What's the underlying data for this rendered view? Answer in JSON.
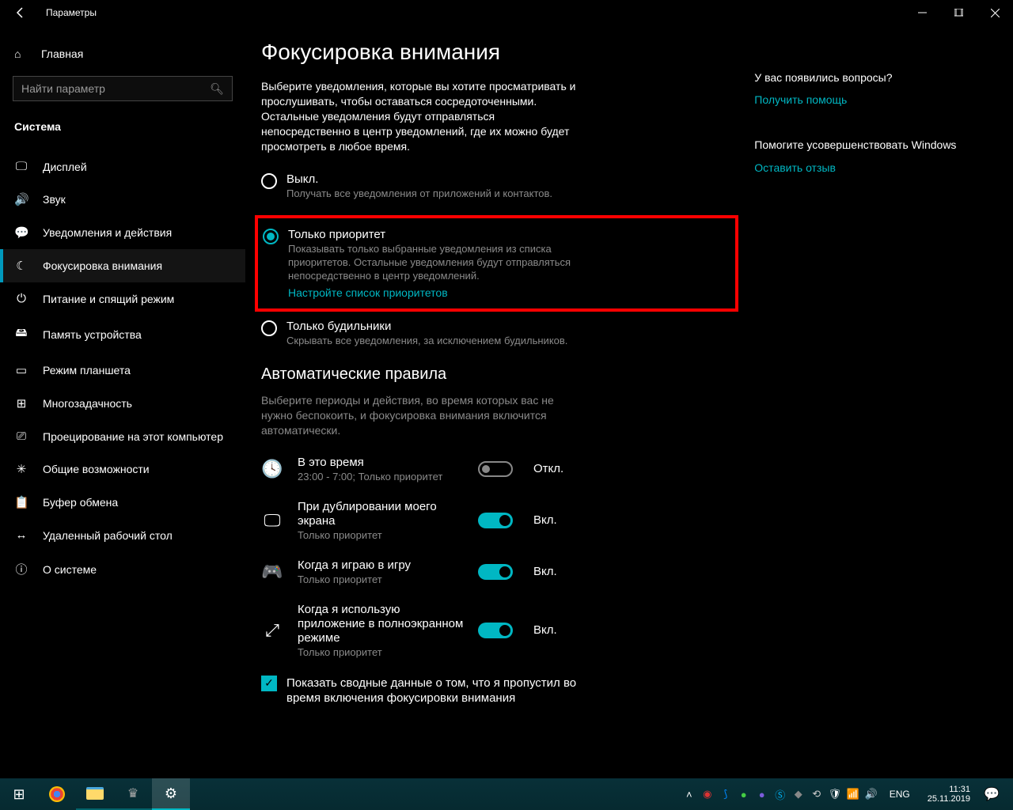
{
  "window": {
    "title": "Параметры"
  },
  "sidebar": {
    "home": "Главная",
    "search_placeholder": "Найти параметр",
    "category": "Система",
    "items": [
      {
        "label": "Дисплей"
      },
      {
        "label": "Звук"
      },
      {
        "label": "Уведомления и действия"
      },
      {
        "label": "Фокусировка внимания"
      },
      {
        "label": "Питание и спящий режим"
      },
      {
        "label": "Память устройства"
      },
      {
        "label": "Режим планшета"
      },
      {
        "label": "Многозадачность"
      },
      {
        "label": "Проецирование на этот компьютер"
      },
      {
        "label": "Общие возможности"
      },
      {
        "label": "Буфер обмена"
      },
      {
        "label": "Удаленный рабочий стол"
      },
      {
        "label": "О системе"
      }
    ]
  },
  "page": {
    "heading": "Фокусировка внимания",
    "description": "Выберите уведомления, которые вы хотите просматривать и прослушивать, чтобы оставаться сосредоточенными. Остальные уведомления будут отправляться непосредственно в центр уведомлений, где их можно будет просмотреть в любое время.",
    "radios": {
      "off": {
        "title": "Выкл.",
        "desc": "Получать все уведомления от приложений и контактов."
      },
      "priority": {
        "title": "Только приоритет",
        "desc": "Показывать только выбранные уведомления из списка приоритетов. Остальные уведомления будут отправляться непосредственно в центр уведомлений.",
        "link": "Настройте список приоритетов"
      },
      "alarms": {
        "title": "Только будильники",
        "desc": "Скрывать все уведомления, за исключением будильников."
      }
    },
    "auto": {
      "heading": "Автоматические правила",
      "desc": "Выберите периоды и действия, во время которых вас не нужно беспокоить, и фокусировка внимания включится автоматически.",
      "rules": [
        {
          "title": "В это время",
          "sub": "23:00 - 7:00; Только приоритет",
          "state": "Откл."
        },
        {
          "title": "При дублировании моего экрана",
          "sub": "Только приоритет",
          "state": "Вкл."
        },
        {
          "title": "Когда я играю в игру",
          "sub": "Только приоритет",
          "state": "Вкл."
        },
        {
          "title": "Когда я использую приложение в полноэкранном режиме",
          "sub": "Только приоритет",
          "state": "Вкл."
        }
      ],
      "summary_check": "Показать сводные данные о том, что я пропустил во время включения фокусировки внимания"
    }
  },
  "aside": {
    "q1": "У вас появились вопросы?",
    "link1": "Получить помощь",
    "q2": "Помогите усовершенствовать Windows",
    "link2": "Оставить отзыв"
  },
  "taskbar": {
    "lang": "ENG",
    "time": "11:31",
    "date": "25.11.2019"
  }
}
